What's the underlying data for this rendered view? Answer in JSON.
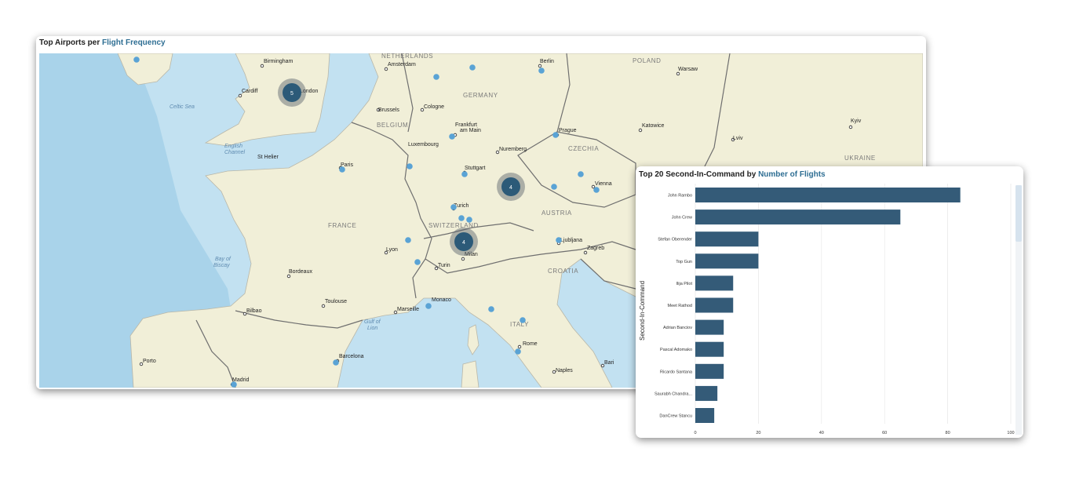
{
  "map_panel": {
    "title_prefix": "Top Airports per",
    "title_highlight": "Flight Frequency",
    "cities": [
      "Birmingham",
      "London",
      "Cardiff",
      "Amsterdam",
      "Berlin",
      "Warsaw",
      "Brussels",
      "Cologne",
      "Frankfurt",
      "am Main",
      "Luxembourg",
      "Prague",
      "Katowice",
      "Kyiv",
      "Lviv",
      "Paris",
      "Stuttgart",
      "Nuremberg",
      "Vienna",
      "Zurich",
      "Lyon",
      "Milan",
      "Turin",
      "Ljubljana",
      "Zagreb",
      "Bordeaux",
      "Toulouse",
      "Marseille",
      "Monaco",
      "Bilbao",
      "Porto",
      "Barcelona",
      "Madrid",
      "Rome",
      "Naples",
      "Bari",
      "St Helier"
    ],
    "countries": [
      "NETHERLANDS",
      "POLAND",
      "GERMANY",
      "BELGIUM",
      "CZECHIA",
      "UKRAINE",
      "FRANCE",
      "SWITZERLAND",
      "AUSTRIA",
      "CROATIA",
      "ITALY"
    ],
    "seas": [
      "Celtic Sea",
      "English",
      "Channel",
      "Bay of",
      "Biscay",
      "Gulf of",
      "Lion"
    ],
    "clusters": [
      5,
      4,
      4
    ]
  },
  "bar_panel": {
    "title_prefix": "Top 20 Second-In-Command by",
    "title_highlight": "Number of Flights",
    "colors": {
      "bar": "#345b78",
      "highlight": "#2e6e93"
    },
    "chart_data": {
      "type": "bar",
      "orientation": "horizontal",
      "title": "Top 20 Second-In-Command by Number of Flights",
      "ylabel": "Second-In-Command",
      "xlabel": "",
      "xlim": [
        0,
        100
      ],
      "xticks": [
        0,
        20,
        40,
        60,
        80,
        100
      ],
      "categories": [
        "John Rambo",
        "John Crew",
        "Stefan Oberender",
        "Top Gun",
        "Ilija Pilot",
        "Meet Rathod",
        "Adrian Banciov",
        "Pascal Adomako",
        "Ricardo Santana",
        "Saurabh Chandra...",
        "DanCrew Stancu"
      ],
      "values": [
        84,
        65,
        20,
        20,
        12,
        12,
        9,
        9,
        9,
        7,
        6
      ],
      "grid": true
    }
  }
}
